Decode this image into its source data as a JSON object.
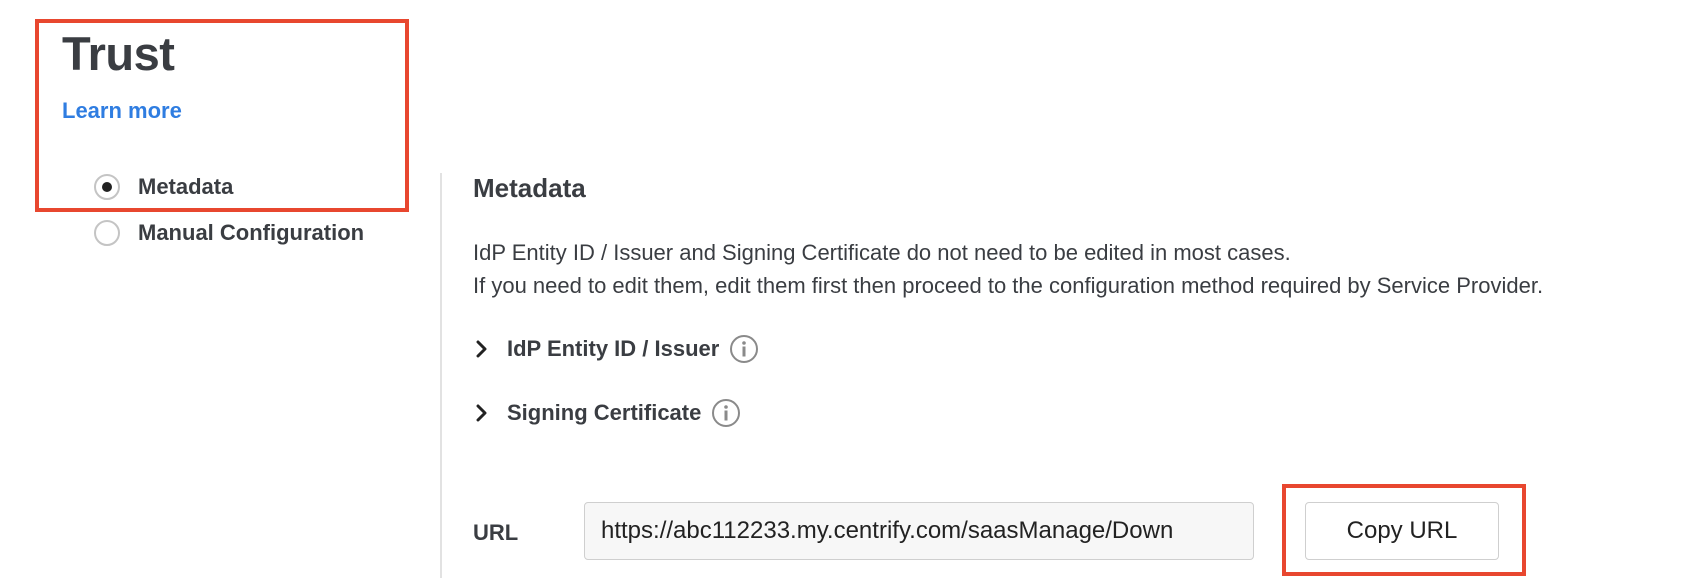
{
  "header": {
    "title": "Trust",
    "learn_more": "Learn more"
  },
  "trust_options": [
    {
      "label": "Metadata",
      "selected": true
    },
    {
      "label": "Manual Configuration",
      "selected": false
    }
  ],
  "metadata": {
    "title": "Metadata",
    "description_line1": "IdP Entity ID / Issuer and Signing Certificate do not need to be edited in most cases.",
    "description_line2": "If you need to edit them, edit them first then proceed to the configuration method required by Service Provider.",
    "sections": [
      {
        "label": "IdP Entity ID / Issuer",
        "icon": "info-icon"
      },
      {
        "label": "Signing Certificate",
        "icon": "info-icon"
      }
    ],
    "url_label": "URL",
    "url_value": "https://abc112233.my.centrify.com/saasManage/Down",
    "copy_button": "Copy URL"
  },
  "colors": {
    "link": "#2f7de1",
    "highlight": "#e8472f",
    "text": "#3a3d42"
  }
}
